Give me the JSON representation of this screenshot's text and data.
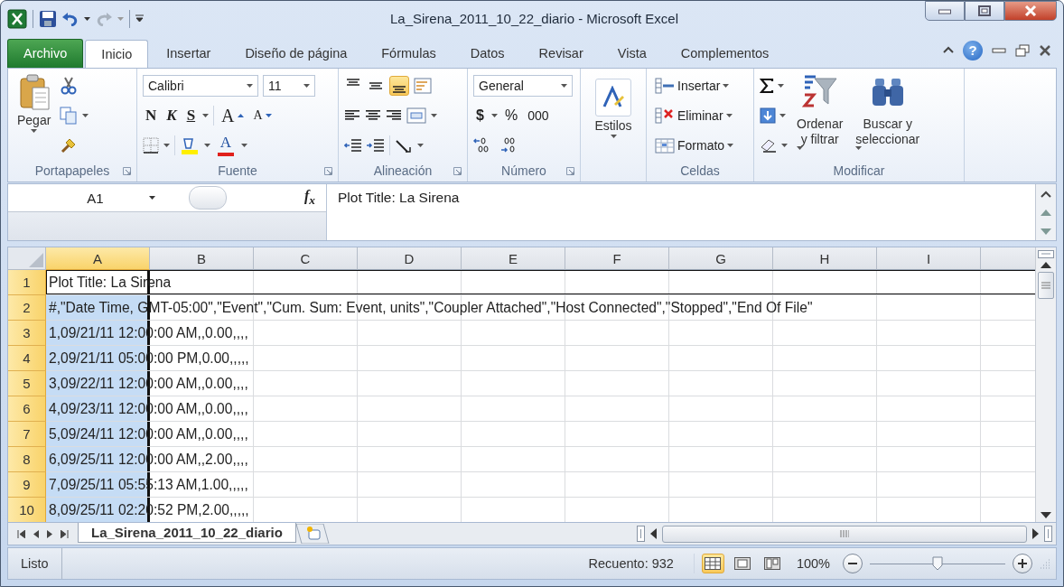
{
  "window": {
    "title": "La_Sirena_2011_10_22_diario  -  Microsoft Excel"
  },
  "ribbon_tabs": [
    {
      "label": "Archivo",
      "kind": "file",
      "selected": false
    },
    {
      "label": "Inicio",
      "kind": "tab",
      "selected": true
    },
    {
      "label": "Insertar",
      "kind": "tab",
      "selected": false
    },
    {
      "label": "Diseño de página",
      "kind": "tab",
      "selected": false
    },
    {
      "label": "Fórmulas",
      "kind": "tab",
      "selected": false
    },
    {
      "label": "Datos",
      "kind": "tab",
      "selected": false
    },
    {
      "label": "Revisar",
      "kind": "tab",
      "selected": false
    },
    {
      "label": "Vista",
      "kind": "tab",
      "selected": false
    },
    {
      "label": "Complementos",
      "kind": "tab",
      "selected": false
    }
  ],
  "help": "?",
  "ribbon": {
    "clipboard": {
      "label": "Portapapeles",
      "paste": "Pegar"
    },
    "font": {
      "label": "Fuente",
      "name": "Calibri",
      "size": "11",
      "bold": "N",
      "italic": "K",
      "underline": "S",
      "grow": "A",
      "shrink": "A",
      "font_color_button": "A"
    },
    "alignment": {
      "label": "Alineación",
      "vertical_align": [
        {
          "kind": "top",
          "selected": false
        },
        {
          "kind": "middle",
          "selected": false
        },
        {
          "kind": "bottom",
          "selected": true
        }
      ]
    },
    "number": {
      "label": "Número",
      "format": "General",
      "currency": "$",
      "percent": "%",
      "thousands": "000"
    },
    "styles": {
      "button": "Estilos"
    },
    "cells": {
      "label": "Celdas",
      "buttons": [
        {
          "kind": "insert",
          "label": "Insertar"
        },
        {
          "kind": "delete",
          "label": "Eliminar"
        },
        {
          "kind": "format",
          "label": "Formato"
        }
      ]
    },
    "editing": {
      "label": "Modificar",
      "sort": [
        "Ordenar",
        "y filtrar"
      ],
      "find": [
        "Buscar y",
        "seleccionar"
      ]
    }
  },
  "formula_bar": {
    "name_box": "A1",
    "function_label": "f$_{x}$",
    "value": "Plot Title: La Sirena"
  },
  "columns": [
    {
      "label": "A",
      "selected": true
    },
    {
      "label": "B",
      "selected": false
    },
    {
      "label": "C",
      "selected": false
    },
    {
      "label": "D",
      "selected": false
    },
    {
      "label": "E",
      "selected": false
    },
    {
      "label": "F",
      "selected": false
    },
    {
      "label": "G",
      "selected": false
    },
    {
      "label": "H",
      "selected": false
    },
    {
      "label": "I",
      "selected": false
    }
  ],
  "rows": [
    {
      "number": "1",
      "selected": true,
      "active": true,
      "text": "Plot Title: La Sirena"
    },
    {
      "number": "2",
      "selected": true,
      "active": false,
      "text": "#,\"Date Time, GMT-05:00\",\"Event\",\"Cum. Sum: Event, units\",\"Coupler Attached\",\"Host Connected\",\"Stopped\",\"End Of File\""
    },
    {
      "number": "3",
      "selected": true,
      "active": false,
      "text": "1,09/21/11 12:00:00 AM,,0.00,,,,"
    },
    {
      "number": "4",
      "selected": true,
      "active": false,
      "text": "2,09/21/11 05:00:00 PM,0.00,,,,,"
    },
    {
      "number": "5",
      "selected": true,
      "active": false,
      "text": "3,09/22/11 12:00:00 AM,,0.00,,,,"
    },
    {
      "number": "6",
      "selected": true,
      "active": false,
      "text": "4,09/23/11 12:00:00 AM,,0.00,,,,"
    },
    {
      "number": "7",
      "selected": true,
      "active": false,
      "text": "5,09/24/11 12:00:00 AM,,0.00,,,,"
    },
    {
      "number": "8",
      "selected": true,
      "active": false,
      "text": "6,09/25/11 12:00:00 AM,,2.00,,,,"
    },
    {
      "number": "9",
      "selected": true,
      "active": false,
      "text": "7,09/25/11 05:55:13 AM,1.00,,,,,"
    },
    {
      "number": "10",
      "selected": true,
      "active": false,
      "text": "8,09/25/11 02:20:52 PM,2.00,,,,,"
    }
  ],
  "sheet_tabs": [
    {
      "label": "La_Sirena_2011_10_22_diario",
      "selected": true
    }
  ],
  "status_bar": {
    "status": "Listo",
    "count": "Recuento: 932",
    "views": [
      {
        "kind": "normal",
        "selected": true
      },
      {
        "kind": "layout",
        "selected": false
      },
      {
        "kind": "page_break",
        "selected": false
      }
    ],
    "zoom": "100%",
    "zoom_slider": {
      "level": 0.5
    }
  }
}
